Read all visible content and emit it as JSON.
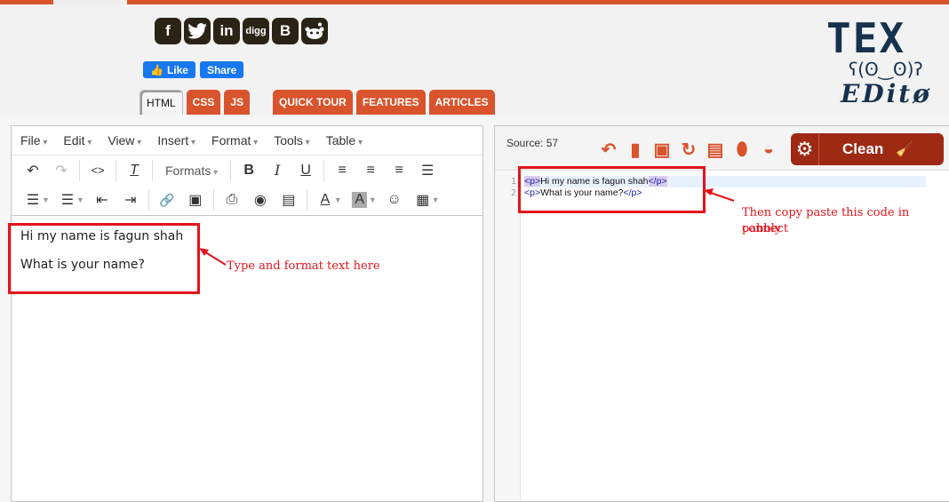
{
  "social": {
    "icons": [
      {
        "name": "facebook-icon",
        "glyph": "f"
      },
      {
        "name": "twitter-icon",
        "glyph": "t"
      },
      {
        "name": "linkedin-icon",
        "glyph": "in"
      },
      {
        "name": "digg-icon",
        "glyph": "digg"
      },
      {
        "name": "blogger-icon",
        "glyph": "B"
      },
      {
        "name": "reddit-icon",
        "glyph": "r"
      }
    ],
    "like_label": "Like",
    "share_label": "Share"
  },
  "tabs": {
    "html": "HTML",
    "css": "CSS",
    "js": "JS",
    "quick_tour": "QUICK TOUR",
    "features": "FEATURES",
    "articles": "ARTICLES"
  },
  "logo": {
    "line1": "TEX",
    "line2": "ʕ(ʘ‿ʘ)ʔ",
    "line3": "EDitø"
  },
  "menubar": [
    "File",
    "Edit",
    "View",
    "Insert",
    "Format",
    "Tools",
    "Table"
  ],
  "toolbar": {
    "formats_label": "Formats"
  },
  "editor": {
    "line1": "Hi my name is fagun shah",
    "line2": "What is your name?"
  },
  "source": {
    "count_label": "Source: 57",
    "clean_label": "Clean",
    "gutter": [
      "1",
      "2"
    ],
    "lines": [
      {
        "open": "<p>",
        "text": "Hi my name is fagun shah",
        "close": "</p>"
      },
      {
        "open": "<p>",
        "text": "What is your name?",
        "close": "</p>"
      }
    ]
  },
  "annotations": {
    "left": "Type and format text here",
    "right_line1": "Then copy paste this code in pabbly",
    "right_line2": "connect"
  },
  "colors": {
    "accent": "#d9532c",
    "clean": "#9e2a14",
    "annotation": "#e4141c"
  }
}
